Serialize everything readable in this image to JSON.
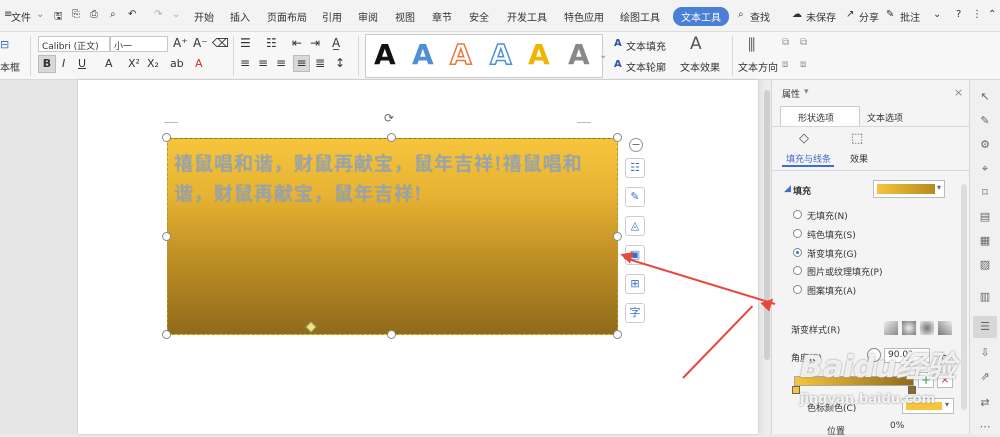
{
  "menubar": {
    "file": "文件",
    "items": [
      "开始",
      "插入",
      "页面布局",
      "引用",
      "审阅",
      "视图",
      "章节",
      "安全",
      "开发工具",
      "特色应用",
      "绘图工具"
    ],
    "active_tab": "文本工具",
    "search": "查找",
    "unsaved": "未保存",
    "share": "分享",
    "comment": "批注"
  },
  "ribbon": {
    "textbox_label": "本框",
    "font_name": "Calibri (正文)",
    "font_size": "小一",
    "wordart_glyph": "A",
    "text_fill": "文本填充",
    "text_outline": "文本轮廓",
    "text_effect": "文本效果",
    "text_direction": "文本方向"
  },
  "document": {
    "textbox_text": "禧鼠唱和谐，财鼠再献宝，鼠年吉祥!禧鼠唱和谐，财鼠再献宝，鼠年吉祥!"
  },
  "panel": {
    "title": "属性",
    "tab_shape": "形状选项",
    "tab_text": "文本选项",
    "sub_fill_line": "填充与线条",
    "sub_effect": "效果",
    "section_fill": "填充",
    "fill_options": [
      "无填充(N)",
      "纯色填充(S)",
      "渐变填充(G)",
      "图片或纹理填充(P)",
      "图案填充(A)"
    ],
    "selected_fill_index": 2,
    "gradient_style": "渐变样式(R)",
    "angle": "角度(E)",
    "angle_value": "90.0°",
    "stop_color": "色标颜色(C)",
    "position": "位置",
    "position_value": "0%"
  },
  "watermark": {
    "brand": "Baidu经验",
    "url": "jingyan.baidu.com"
  }
}
